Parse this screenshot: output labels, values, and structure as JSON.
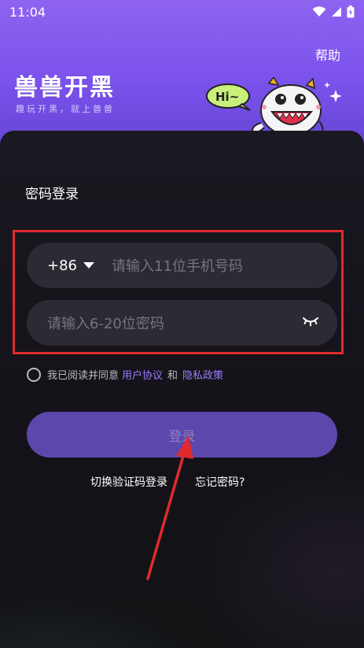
{
  "status_bar": {
    "time": "11:04"
  },
  "header": {
    "help_label": "帮助",
    "logo_text": "兽兽开黑",
    "slogan": "趣玩开黑，就上兽兽",
    "mascot_bubble": "Hi~"
  },
  "login": {
    "title": "密码登录",
    "country_code": "+86",
    "phone_placeholder": "请输入11位手机号码",
    "password_placeholder": "请输入6-20位密码",
    "agreement_prefix": "我已阅读并同意",
    "user_agreement": "用户协议",
    "and_text": "和",
    "privacy_policy": "隐私政策",
    "login_button": "登录",
    "switch_to_code": "切换验证码登录",
    "forgot_password": "忘记密码?"
  },
  "colors": {
    "hero_purple": "#8f63f0",
    "button_purple": "#5c47ad",
    "link_purple": "#9b7cff",
    "annotation_red": "#e02a2e"
  }
}
